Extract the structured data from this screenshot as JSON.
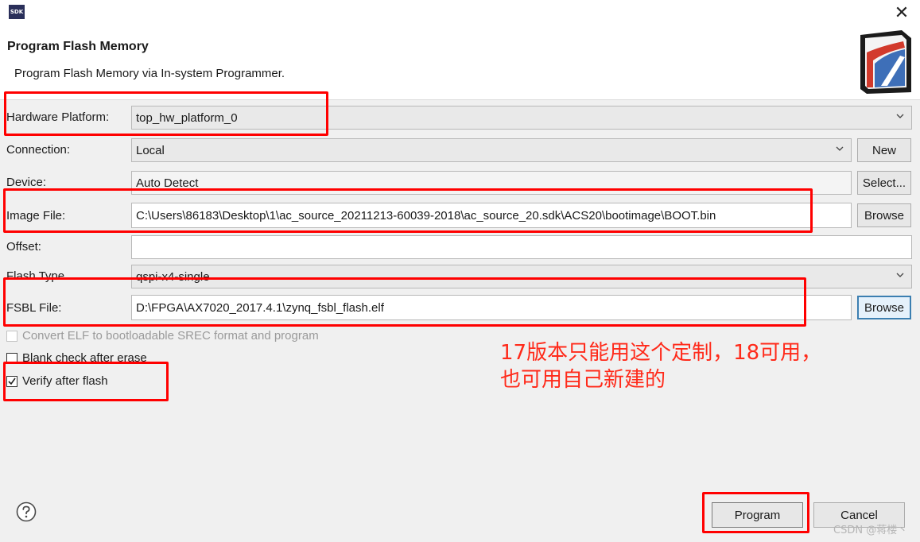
{
  "window": {
    "app_icon_text": "SDK",
    "close_icon": "close-icon",
    "title": "Program Flash Memory",
    "subtitle": "Program Flash Memory via In-system Programmer.",
    "banner_icon": "flash-wizard-icon"
  },
  "form": {
    "hardware_platform": {
      "label": "Hardware Platform:",
      "value": "top_hw_platform_0"
    },
    "connection": {
      "label": "Connection:",
      "value": "Local",
      "new_button": "New"
    },
    "device": {
      "label": "Device:",
      "value": "Auto Detect",
      "select_button": "Select..."
    },
    "image_file": {
      "label": "Image File:",
      "value": "C:\\Users\\86183\\Desktop\\1\\ac_source_20211213-60039-2018\\ac_source_20.sdk\\ACS20\\bootimage\\BOOT.bin",
      "browse_button": "Browse"
    },
    "offset": {
      "label": "Offset:",
      "value": ""
    },
    "flash_type": {
      "label": "Flash Type",
      "value": "qspi-x4-single"
    },
    "fsbl_file": {
      "label": "FSBL File:",
      "value": "D:\\FPGA\\AX7020_2017.4.1\\zynq_fsbl_flash.elf",
      "browse_button": "Browse"
    },
    "options": {
      "convert_elf": {
        "label": "Convert ELF to bootloadable SREC format and program",
        "checked": false,
        "enabled": false
      },
      "blank_check": {
        "label": "Blank check after erase",
        "checked": false,
        "enabled": true
      },
      "verify": {
        "label": "Verify after flash",
        "checked": true,
        "enabled": true
      }
    }
  },
  "annotation": {
    "line1": "17版本只能用这个定制，18可用，",
    "line2": "也可用自己新建的",
    "color": "#ff2a1a"
  },
  "footer": {
    "help_icon": "help-icon",
    "program_button": "Program",
    "cancel_button": "Cancel",
    "watermark": "CSDN @蒋楼丶"
  },
  "colors": {
    "highlight": "#ff0000",
    "focus_border": "#3c7fb1",
    "window_bg": "#f0f0f0"
  }
}
